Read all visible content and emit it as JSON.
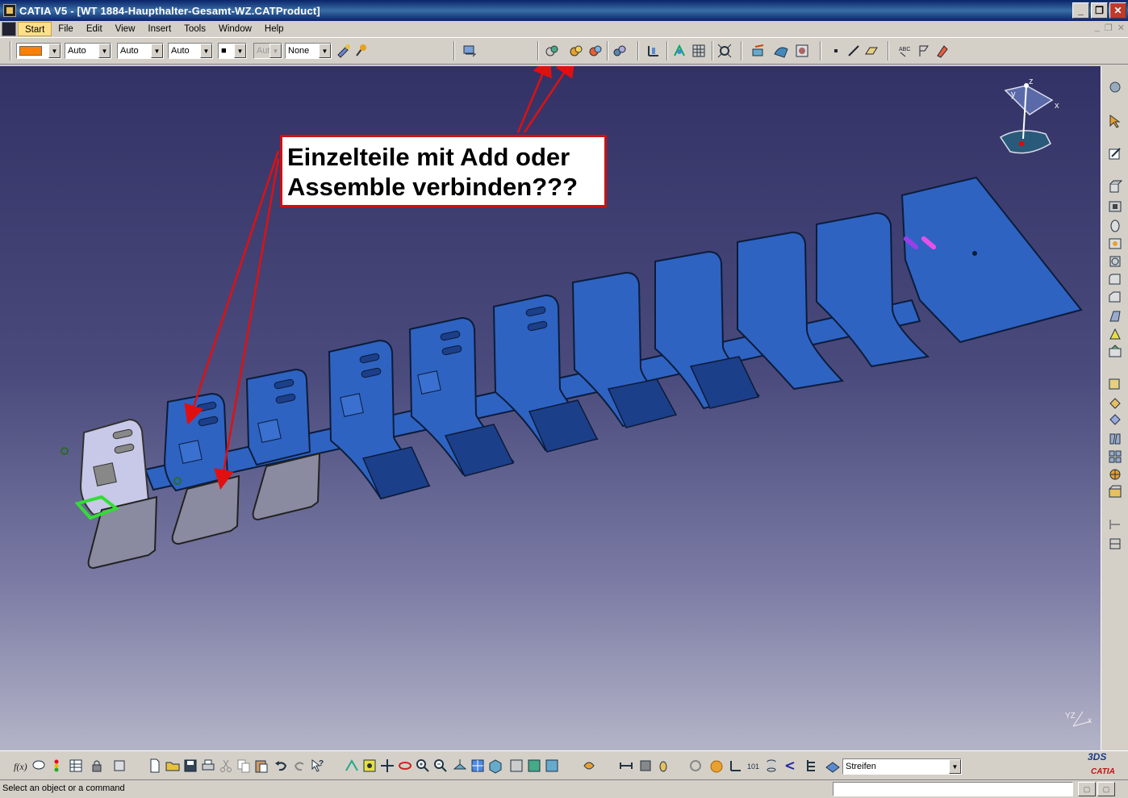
{
  "window": {
    "title": "CATIA V5 - [WT 1884-Haupthalter-Gesamt-WZ.CATProduct]",
    "minimize": "_",
    "restore": "❐",
    "close": "✕"
  },
  "menu": {
    "items": [
      "Start",
      "File",
      "Edit",
      "View",
      "Insert",
      "Tools",
      "Window",
      "Help"
    ]
  },
  "toolbar_top": {
    "color_value": "",
    "combo1": "Auto",
    "combo2": "Auto",
    "combo3": "Auto",
    "combo4": "■",
    "combo5": "Aut",
    "combo6": "None"
  },
  "callout": {
    "line1": "Einzelteile mit Add oder",
    "line2": "Assemble verbinden???"
  },
  "toolbar_bottom": {
    "layer_combo": "Streifen"
  },
  "status": {
    "message": "Select an object or a command"
  },
  "logo": {
    "brand": "CATIA",
    "mark": "3DS"
  },
  "colors": {
    "part_blue": "#2e63c2",
    "part_dark": "#1c3f8a",
    "callout_border": "#d01010",
    "arrow_red": "#e01010",
    "selected_green": "#33dd33"
  }
}
